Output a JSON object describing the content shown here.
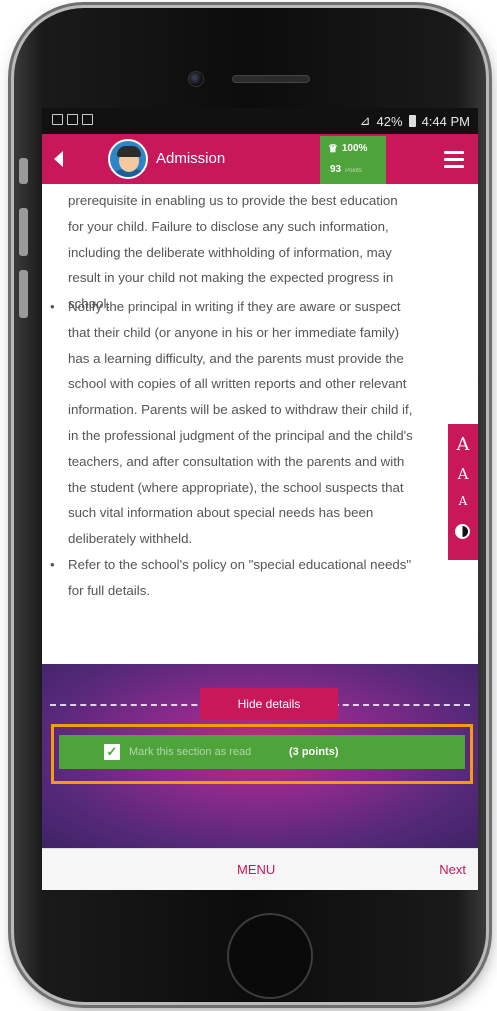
{
  "status_bar": {
    "battery": "42%",
    "time": "4:44 PM"
  },
  "header": {
    "back_icon": "chevron-left-icon",
    "title": "Admission",
    "progress": "100%",
    "points": "93",
    "points_label": "Points",
    "menu_icon": "hamburger-icon"
  },
  "content": {
    "intro_lines": [
      "prerequisite in enabling us to provide the best education",
      "for your child. Failure to disclose any such information,",
      "including the deliberate withholding of information, may",
      "result in your child not making the expected progress in",
      "school."
    ],
    "bullets": [
      {
        "lines": [
          "Notify the principal in writing if they are aware or suspect",
          "that their child (or anyone in his or her immediate family)",
          "has a learning difficulty, and the parents must provide the",
          "school with copies of all written reports and other relevant",
          "information. Parents will be asked to withdraw their child if,",
          "in the professional judgment of the principal and the child's",
          "teachers, and after consultation with the parents and with",
          "the student (where appropriate), the school suspects that",
          "such vital information about special needs has been",
          "deliberately withheld."
        ]
      },
      {
        "lines": [
          "Refer to the school's policy on \"special educational needs\"",
          "for full details."
        ]
      }
    ]
  },
  "font_panel": {
    "large": "A",
    "medium": "A",
    "small": "A",
    "contrast_icon": "contrast-icon"
  },
  "section": {
    "hide_details": "Hide details",
    "mark_read_label": "Mark this section as read",
    "mark_read_points": "(3 points)",
    "checked": true
  },
  "footer": {
    "menu_label": "MENU",
    "next_label": "Next"
  },
  "colors": {
    "brand": "#c8185a",
    "success": "#4ea43a",
    "highlight": "#f39c12"
  }
}
